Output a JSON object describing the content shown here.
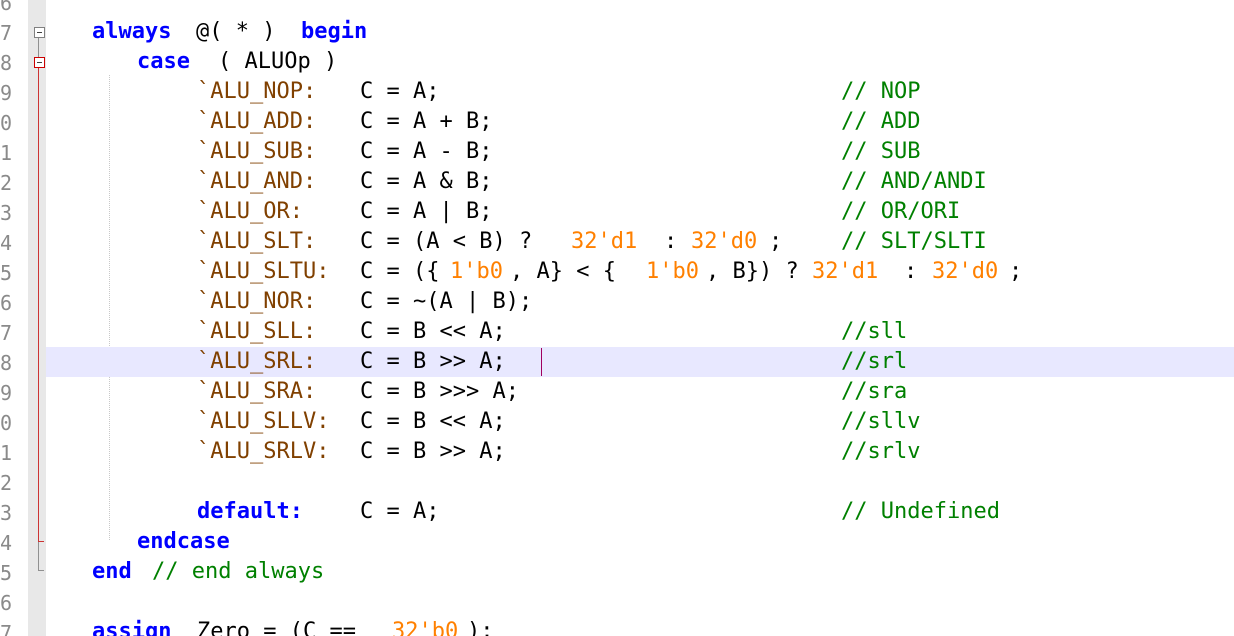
{
  "gutter": {
    "line_numbers": [
      "6",
      "7",
      "8",
      "9",
      "0",
      "1",
      "2",
      "3",
      "4",
      "5",
      "6",
      "7",
      "8",
      "9",
      "0",
      "1",
      "2",
      "3",
      "4",
      "5",
      "6",
      "7"
    ]
  },
  "code": {
    "line_7": {
      "always": "always",
      "sensitivity": "@( * )",
      "begin": "begin"
    },
    "line_8": {
      "case": "case",
      "expr": "( ALUOp )"
    },
    "line_9": {
      "label": "`ALU_NOP:",
      "stmt": "C = A;",
      "comment": "// NOP"
    },
    "line_10": {
      "label": "`ALU_ADD:",
      "stmt": "C = A + B;",
      "comment": "// ADD"
    },
    "line_11": {
      "label": "`ALU_SUB:",
      "stmt": "C = A - B;",
      "comment": "// SUB"
    },
    "line_12": {
      "label": "`ALU_AND:",
      "stmt": "C = A & B;",
      "comment": "// AND/ANDI"
    },
    "line_13": {
      "label": "`ALU_OR:",
      "stmt": "C = A | B;",
      "comment": "// OR/ORI"
    },
    "line_14": {
      "label": "`ALU_SLT:",
      "stmt_a": "C = (A < B) ?",
      "num1": "32'd1",
      "colon": ":",
      "num2": "32'd0",
      "semi": ";",
      "comment": "// SLT/SLTI"
    },
    "line_15": {
      "label": "`ALU_SLTU:",
      "p1": "C = ({",
      "n1": "1'b0",
      "p2": ", A} < {",
      "n2": "1'b0",
      "p3": ", B}) ?",
      "n3": "32'd1",
      "p4": ":",
      "n4": "32'd0",
      "p5": ";"
    },
    "line_16": {
      "label": "`ALU_NOR:",
      "stmt": "C = ~(A | B);"
    },
    "line_17": {
      "label": "`ALU_SLL:",
      "stmt": "C = B << A;",
      "comment": "//sll"
    },
    "line_18": {
      "label": "`ALU_SRL:",
      "stmt": "C = B >> A;",
      "comment": "//srl"
    },
    "line_19": {
      "label": "`ALU_SRA:",
      "stmt": "C = B >>> A;",
      "comment": "//sra"
    },
    "line_20": {
      "label": "`ALU_SLLV:",
      "stmt": "C = B << A;",
      "comment": "//sllv"
    },
    "line_21": {
      "label": "`ALU_SRLV:",
      "stmt": "C = B >> A;",
      "comment": "//srlv"
    },
    "line_23": {
      "default": "default:",
      "stmt": "C = A;",
      "comment": "// Undefined"
    },
    "line_24": {
      "endcase": "endcase"
    },
    "line_25": {
      "end": "end",
      "comment": "// end always"
    },
    "line_27": {
      "assign": "assign",
      "stmt": "Zero = (C ==",
      "num": "32'b0",
      "tail": ");"
    }
  },
  "colors": {
    "keyword": "#0000ff",
    "macro": "#804000",
    "number": "#ff8000",
    "comment": "#008000",
    "operator": "#000080",
    "current_line": "#e8e8ff",
    "caret": "#a00060",
    "fold_marker": "#cc3333"
  },
  "icons": [
    "fold-minus-icon",
    "fold-minus-icon"
  ]
}
